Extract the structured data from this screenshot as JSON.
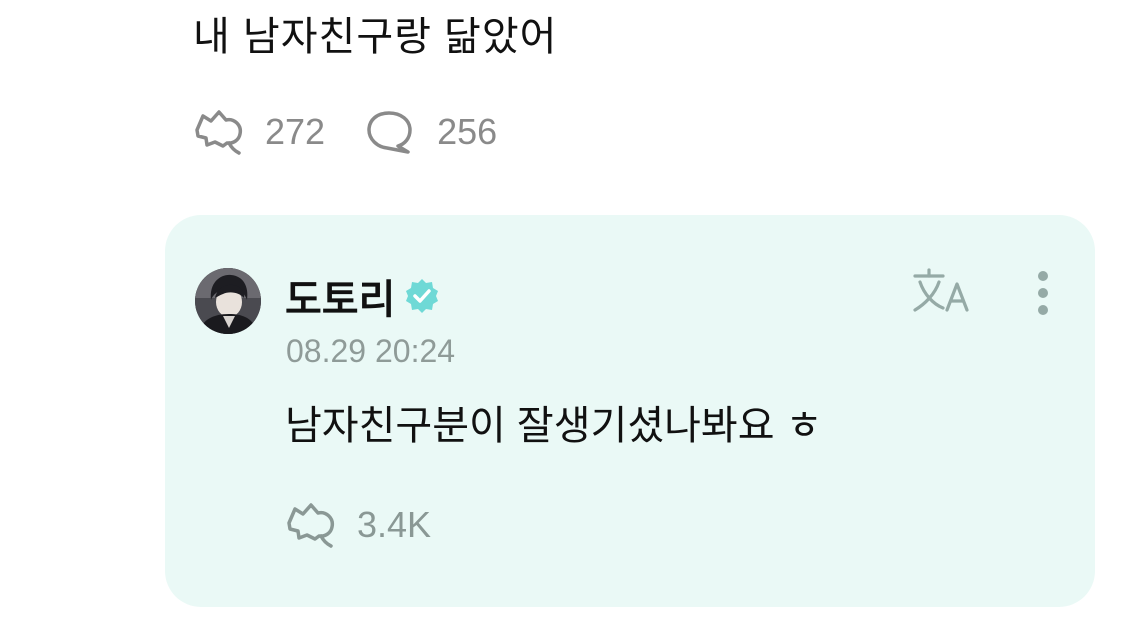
{
  "post": {
    "text": "내 남자친구랑 닮았어",
    "like_count": "272",
    "reply_count": "256"
  },
  "comment": {
    "author": "도토리",
    "timestamp": "08.29 20:24",
    "text": "남자친구분이 잘생기셨나봐요 ㅎ",
    "like_count": "3.4K",
    "background_color": "#eaf9f6",
    "verified_color": "#6fd9d6"
  },
  "icons": {
    "like": "heart-plus-icon",
    "reply": "speech-bubble-icon",
    "translate": "translate-icon",
    "more": "more-vertical-icon",
    "verified": "verified-badge-icon"
  }
}
